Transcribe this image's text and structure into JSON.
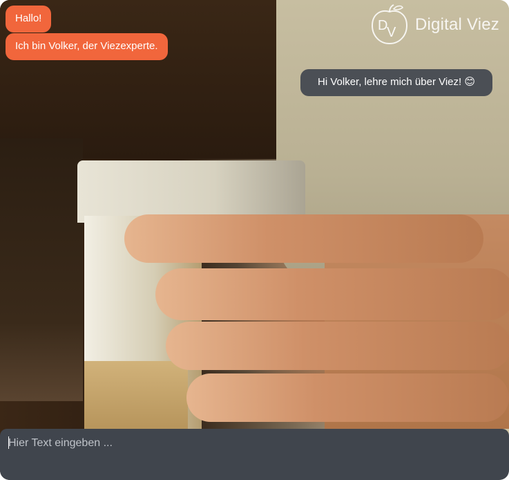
{
  "brand": {
    "logo_monogram": "DV",
    "name": "Digital Viez"
  },
  "chat": {
    "messages": [
      {
        "sender": "bot",
        "text": "Hallo!"
      },
      {
        "sender": "bot",
        "text": "Ich bin Volker, der Viezexperte."
      },
      {
        "sender": "user",
        "text": "Hi Volker, lehre mich über Viez! 😊"
      }
    ]
  },
  "composer": {
    "value": "",
    "placeholder": "Hier Text eingeben ..."
  },
  "colors": {
    "bot_bubble": "#f1663c",
    "user_bubble": "#4b4f55",
    "input_bar": "#40454d"
  },
  "icons": {
    "logo": "digital-viez-apple-logo-icon"
  }
}
